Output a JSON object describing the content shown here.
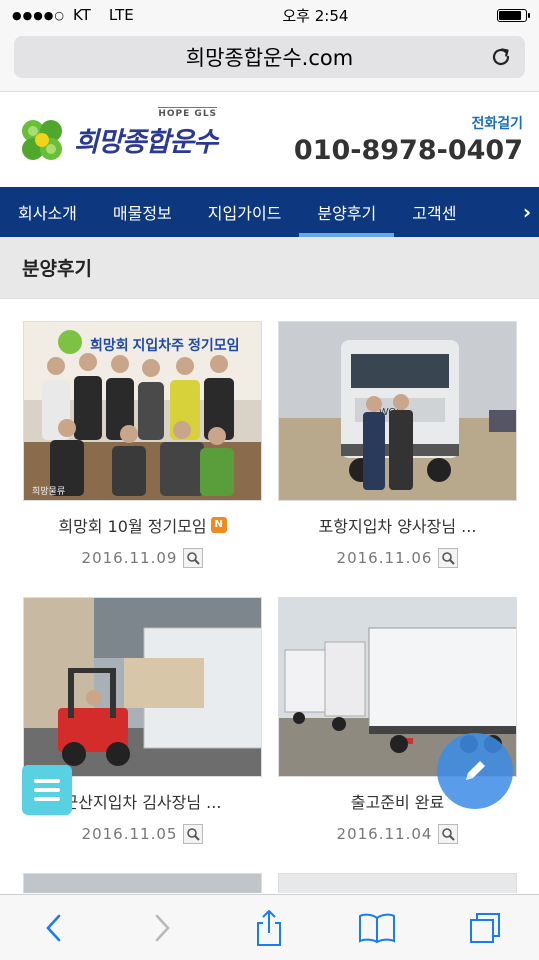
{
  "status": {
    "carrier": "KT",
    "network": "LTE",
    "time": "오후 2:54",
    "battery_level": 0.9
  },
  "browser": {
    "url": "희망종합운수.com"
  },
  "header": {
    "logo_sub": "HOPE GLS",
    "logo_text": "희망종합운수",
    "call_label": "전화걸기",
    "phone": "010-8978-0407"
  },
  "nav": {
    "items": [
      {
        "label": "회사소개"
      },
      {
        "label": "매물정보"
      },
      {
        "label": "지입가이드"
      },
      {
        "label": "분양후기"
      },
      {
        "label": "고객센"
      }
    ],
    "active_index": 3
  },
  "page": {
    "title": "분양후기"
  },
  "posts": [
    {
      "title": "희망회 10월 정기모임",
      "date": "2016.11.09",
      "new_badge": "N",
      "thumb_caption": "희망회 지입차주 정기모임"
    },
    {
      "title": "포항지입차 양사장님 ...",
      "date": "2016.11.06"
    },
    {
      "title": "군산지입차 김사장님 ...",
      "date": "2016.11.05"
    },
    {
      "title": "출고준비 완료",
      "date": "2016.11.04"
    }
  ],
  "colors": {
    "nav_bg": "#0d3880",
    "nav_active": "#68a6e4",
    "logo_green": "#5fb730",
    "accent_blue": "#1a6fb8",
    "new_badge": "#ef8b1f"
  }
}
